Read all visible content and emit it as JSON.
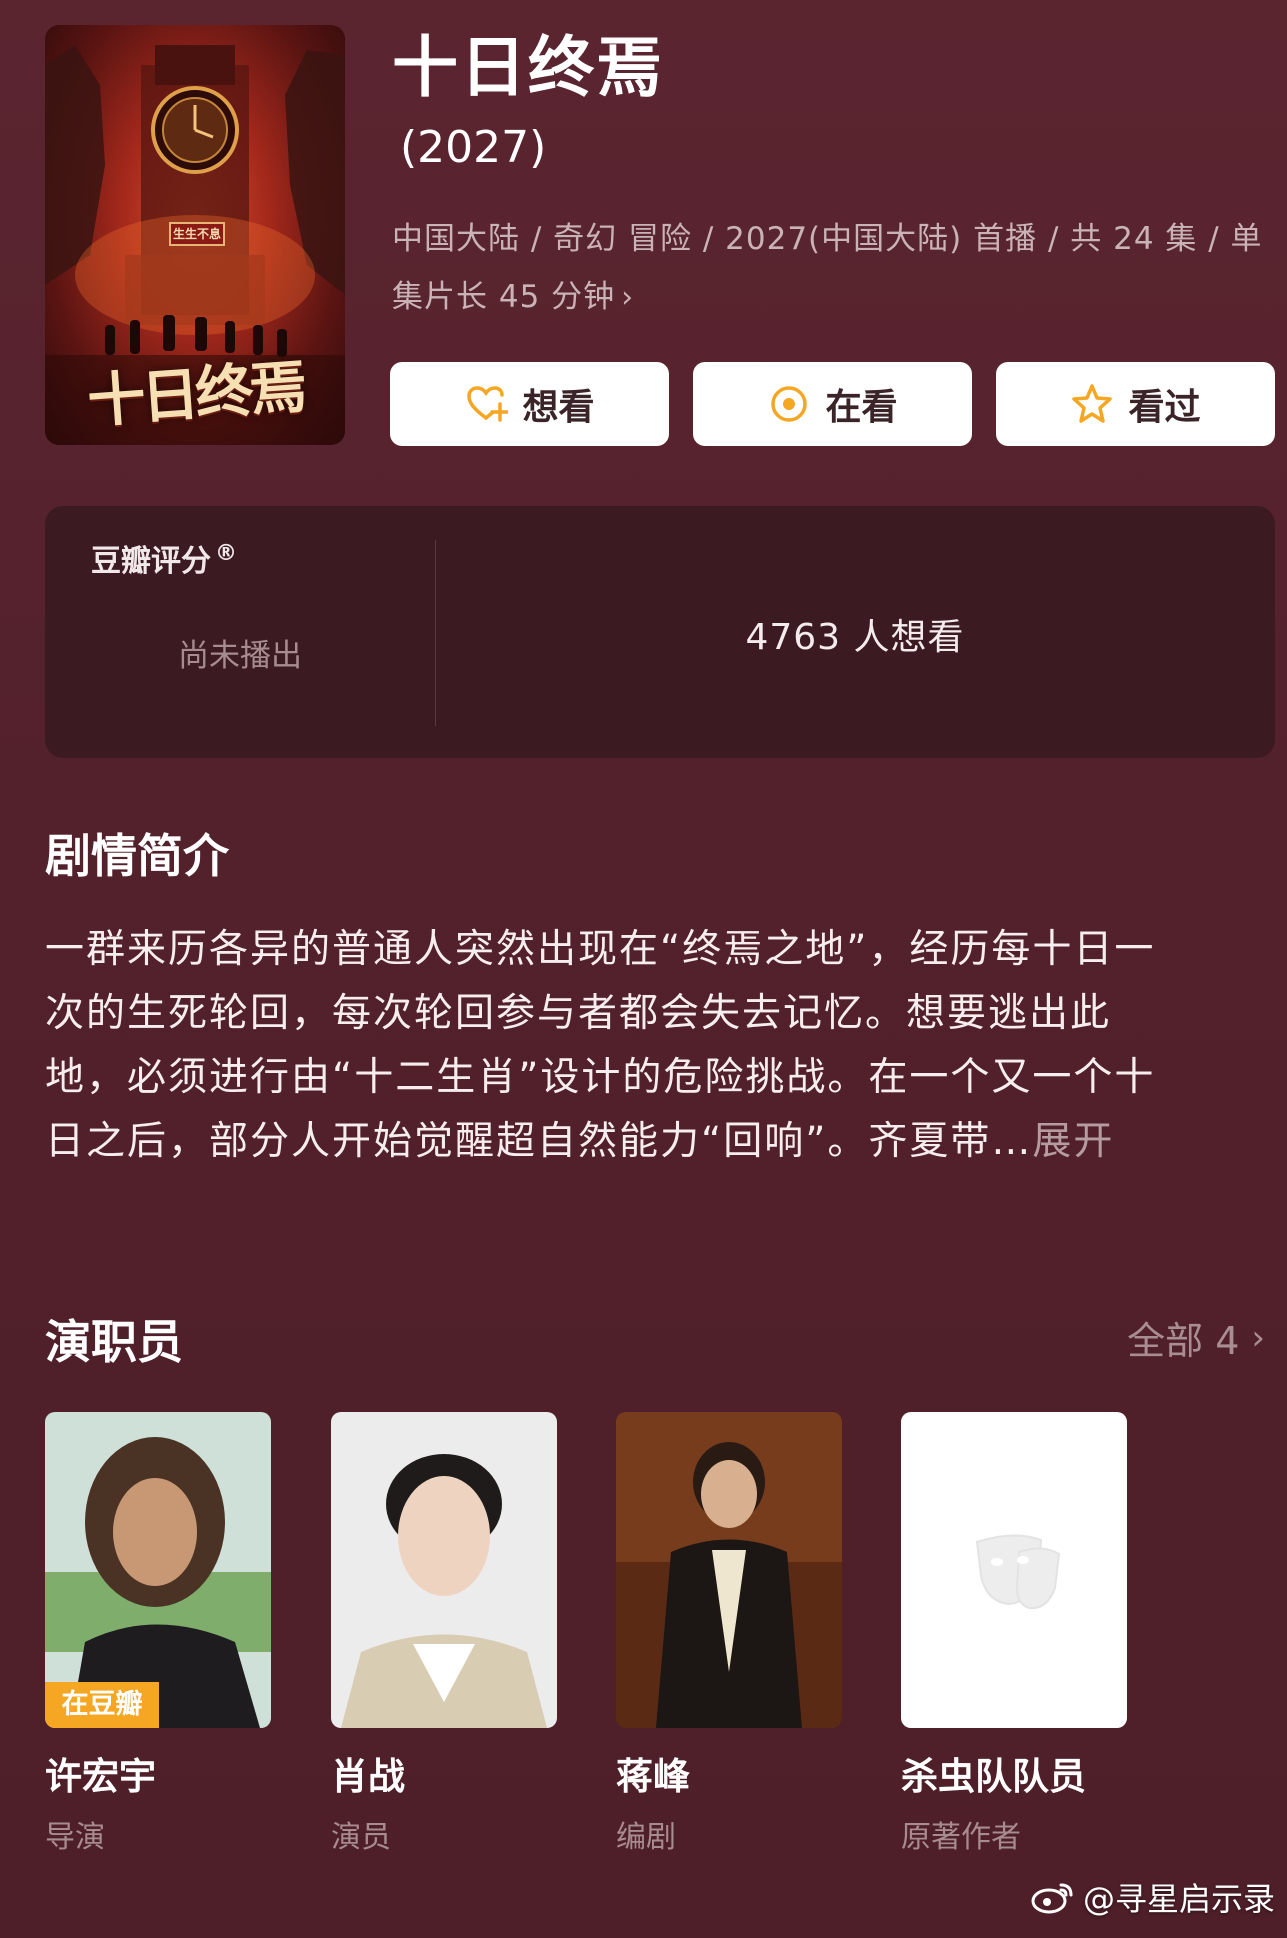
{
  "show": {
    "title": "十日终焉",
    "year": "(2027)",
    "meta": "中国大陆 / 奇幻 冒险 / 2027(中国大陆) 首播 / 共 24 集 / 单集片长 45 分钟",
    "poster_text": "十日终焉",
    "poster_plaque": "生生不息"
  },
  "actions": {
    "want": "想看",
    "watching": "在看",
    "watched": "看过"
  },
  "rating": {
    "label": "豆瓣评分",
    "mark": "®",
    "status": "尚未播出",
    "want_count": "4763 人想看"
  },
  "synopsis": {
    "title": "剧情简介",
    "lines": [
      "一群来历各异的普通人突然出现在“终焉之地”，经历每十日一",
      "次的生死轮回，每次轮回参与者都会失去记忆。想要逃出此",
      "地，必须进行由“十二生肖”设计的危险挑战。在一个又一个十",
      "日之后，部分人开始觉醒超自然能力“回响”。齐夏带…"
    ],
    "expand": "展开"
  },
  "cast": {
    "title": "演职员",
    "see_all": "全部 4",
    "members": [
      {
        "name": "许宏宇",
        "role": "导演",
        "tag": "在豆瓣"
      },
      {
        "name": "肖战",
        "role": "演员"
      },
      {
        "name": "蒋峰",
        "role": "编剧"
      },
      {
        "name": "杀虫队队员",
        "role": "原著作者"
      }
    ]
  },
  "watermark": "@寻星启示录",
  "colors": {
    "background": "#5b2530",
    "card": "#3b1b21",
    "accent_orange": "#f5a623",
    "muted_text": "#a68b8f"
  },
  "icons": [
    "heart-plus-icon",
    "target-circle-icon",
    "star-outline-icon",
    "chevron-right-icon",
    "theater-masks-icon",
    "weibo-icon"
  ]
}
